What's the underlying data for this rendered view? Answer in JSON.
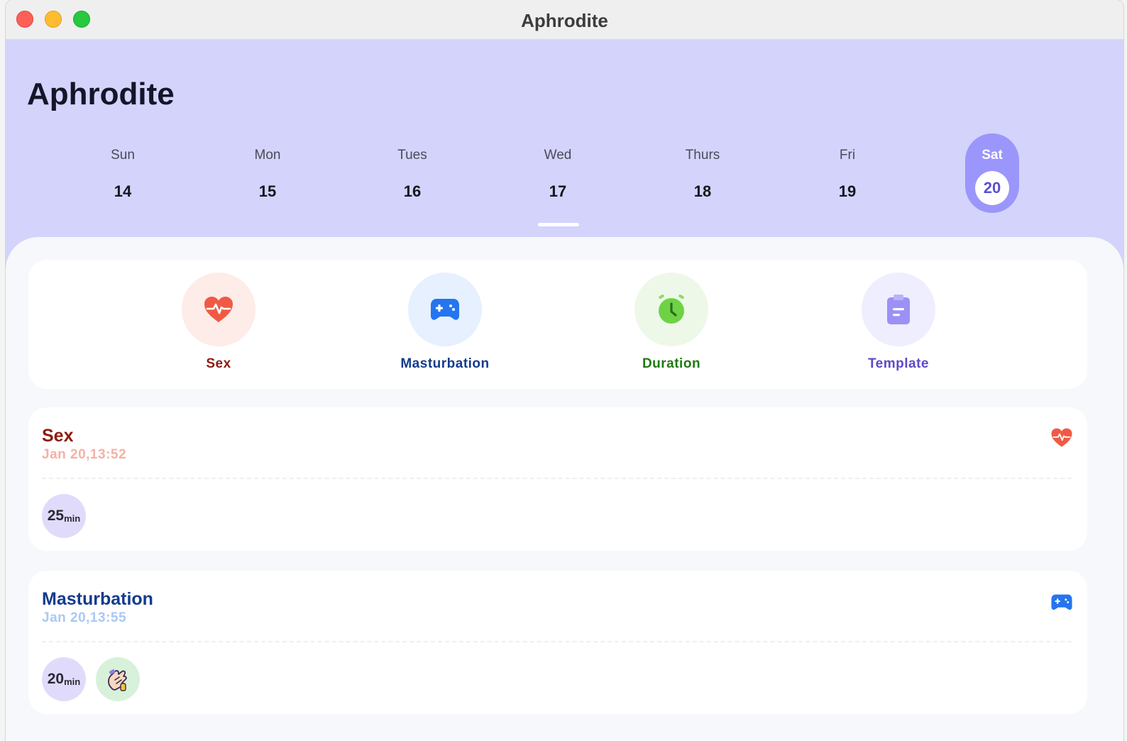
{
  "window": {
    "title": "Aphrodite"
  },
  "header": {
    "title": "Aphrodite"
  },
  "week": [
    {
      "name": "Sun",
      "date": "14"
    },
    {
      "name": "Mon",
      "date": "15"
    },
    {
      "name": "Tues",
      "date": "16"
    },
    {
      "name": "Wed",
      "date": "17"
    },
    {
      "name": "Thurs",
      "date": "18"
    },
    {
      "name": "Fri",
      "date": "19"
    },
    {
      "name": "Sat",
      "date": "20",
      "selected": true
    }
  ],
  "actions": [
    {
      "label": "Sex",
      "icon": "heart-pulse-icon",
      "color": "#8b1c10",
      "bg": "#fdece8",
      "icon_color": "#f05a45"
    },
    {
      "label": "Masturbation",
      "icon": "gamepad-icon",
      "color": "#123c8c",
      "bg": "#e6f0fe",
      "icon_color": "#2575f0"
    },
    {
      "label": "Duration",
      "icon": "alarm-clock-icon",
      "color": "#1f7a12",
      "bg": "#eef8e8",
      "icon_color": "#6fd245"
    },
    {
      "label": "Template",
      "icon": "clipboard-icon",
      "color": "#5b4ac8",
      "bg": "#efeefe",
      "icon_color": "#9b91f5"
    }
  ],
  "entries": [
    {
      "title": "Sex",
      "time": "Jan 20,13:52",
      "title_color": "#8b1c10",
      "time_color": "#f5b1a5",
      "icon": "heart-pulse-icon",
      "duration": "25",
      "unit": "min"
    },
    {
      "title": "Masturbation",
      "time": "Jan 20,13:55",
      "title_color": "#123c8c",
      "time_color": "#a9c8f6",
      "icon": "gamepad-icon",
      "duration": "20",
      "unit": "min",
      "extra_icon": "hand-lotion-icon"
    }
  ],
  "colors": {
    "header_bg": "#d4d3fb",
    "selected_day_bg": "#9b96fb",
    "duration_chip_bg": "#e1dbfb",
    "tag_chip_bg": "#d8f1da"
  }
}
